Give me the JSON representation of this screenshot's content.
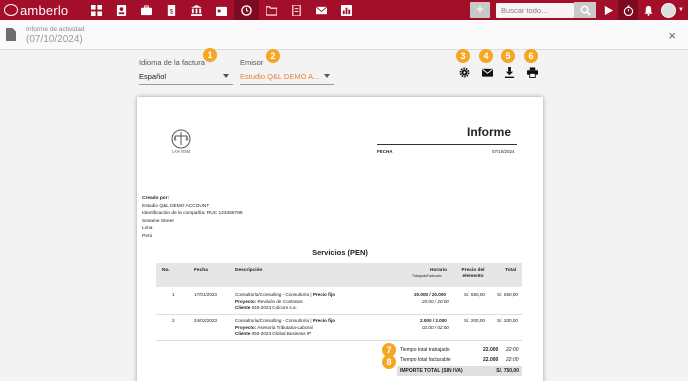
{
  "app": {
    "name": "amberlo"
  },
  "topbar": {
    "nav_icons": [
      "dashboard-icon",
      "contacts-icon",
      "briefcase-icon",
      "invoice-icon",
      "bank-icon",
      "calendar-icon",
      "time-entry-icon",
      "folder-icon",
      "documents-icon",
      "mail-icon",
      "reports-icon"
    ],
    "active_index": 6,
    "plus_label": "+",
    "search_placeholder": "Buscar todo..."
  },
  "subheader": {
    "label": "Informe de actividad",
    "date": "(07/10/2024)",
    "close_label": "×"
  },
  "form": {
    "language_label": "Idioma de la factura",
    "language_value": "Español",
    "issuer_label": "Emisor",
    "issuer_value": "Estudio Q&L DEMO A..."
  },
  "badges": [
    "1",
    "2",
    "3",
    "4",
    "5",
    "6",
    "7",
    "8"
  ],
  "actions": [
    "settings-icon",
    "email-icon",
    "download-icon",
    "print-icon"
  ],
  "colors": {
    "brand": "#a30e2a",
    "badge": "#f5a623",
    "issuer_text": "#e8823a"
  },
  "preview": {
    "logo_text": "LAW FIRM",
    "title": "Informe",
    "fecha_label": "FECHA",
    "fecha_value": "07/10/2024",
    "creado_label": "Creado por:",
    "creado_lines": [
      "Estudio Q&L DEMO ACCOUNT",
      "Identificación de la compañía: RUC 123456789",
      "Sesame Street",
      "Lima",
      "Perú"
    ],
    "section_title": "Servicios (PEN)",
    "columns": {
      "no": "No.",
      "fecha": "Fecha",
      "descripcion": "Descripción",
      "horario": "Horario",
      "horario_sub": "Trabajado/Facturado",
      "precio": "Precio del elemento",
      "total": "Total"
    },
    "rows": [
      {
        "no": "1",
        "fecha": "17/01/2023",
        "desc_line1": "Consultoría/Consulting - Consultoría",
        "desc_fixed": "Precio fijo",
        "proyecto_label": "Proyecto:",
        "proyecto": "Revisión de Contratos",
        "cliente_label": "Cliente",
        "cliente": "045-2023 Colcore s.a.",
        "horario": "20.000 / 20.000",
        "horario_sub": "20:00 / 20:00",
        "precio": "S/. 550,00",
        "total": "S/. 550,00"
      },
      {
        "no": "2",
        "fecha": "24/02/2023",
        "desc_line1": "Consultoría/Consulting - Consultoría",
        "desc_fixed": "Precio fijo",
        "proyecto_label": "Proyecto:",
        "proyecto": "Asesoría Tributaria-Laboral",
        "cliente_label": "Cliente",
        "cliente": "050-2023 Global Business IP",
        "horario": "2.000 / 2.000",
        "horario_sub": "02:00 / 02:00",
        "precio": "S/. 200,00",
        "total": "S/. 200,00"
      }
    ],
    "summary": {
      "worked_label": "Tiempo total trabajado",
      "worked_value": "22.000",
      "worked_time": "22:00",
      "billable_label": "Tiempo total facturable",
      "billable_value": "22.000",
      "billable_time": "22:00",
      "total_label": "IMPORTE TOTAL (SIN IVA)",
      "total_value": "S/. 750,00"
    }
  }
}
